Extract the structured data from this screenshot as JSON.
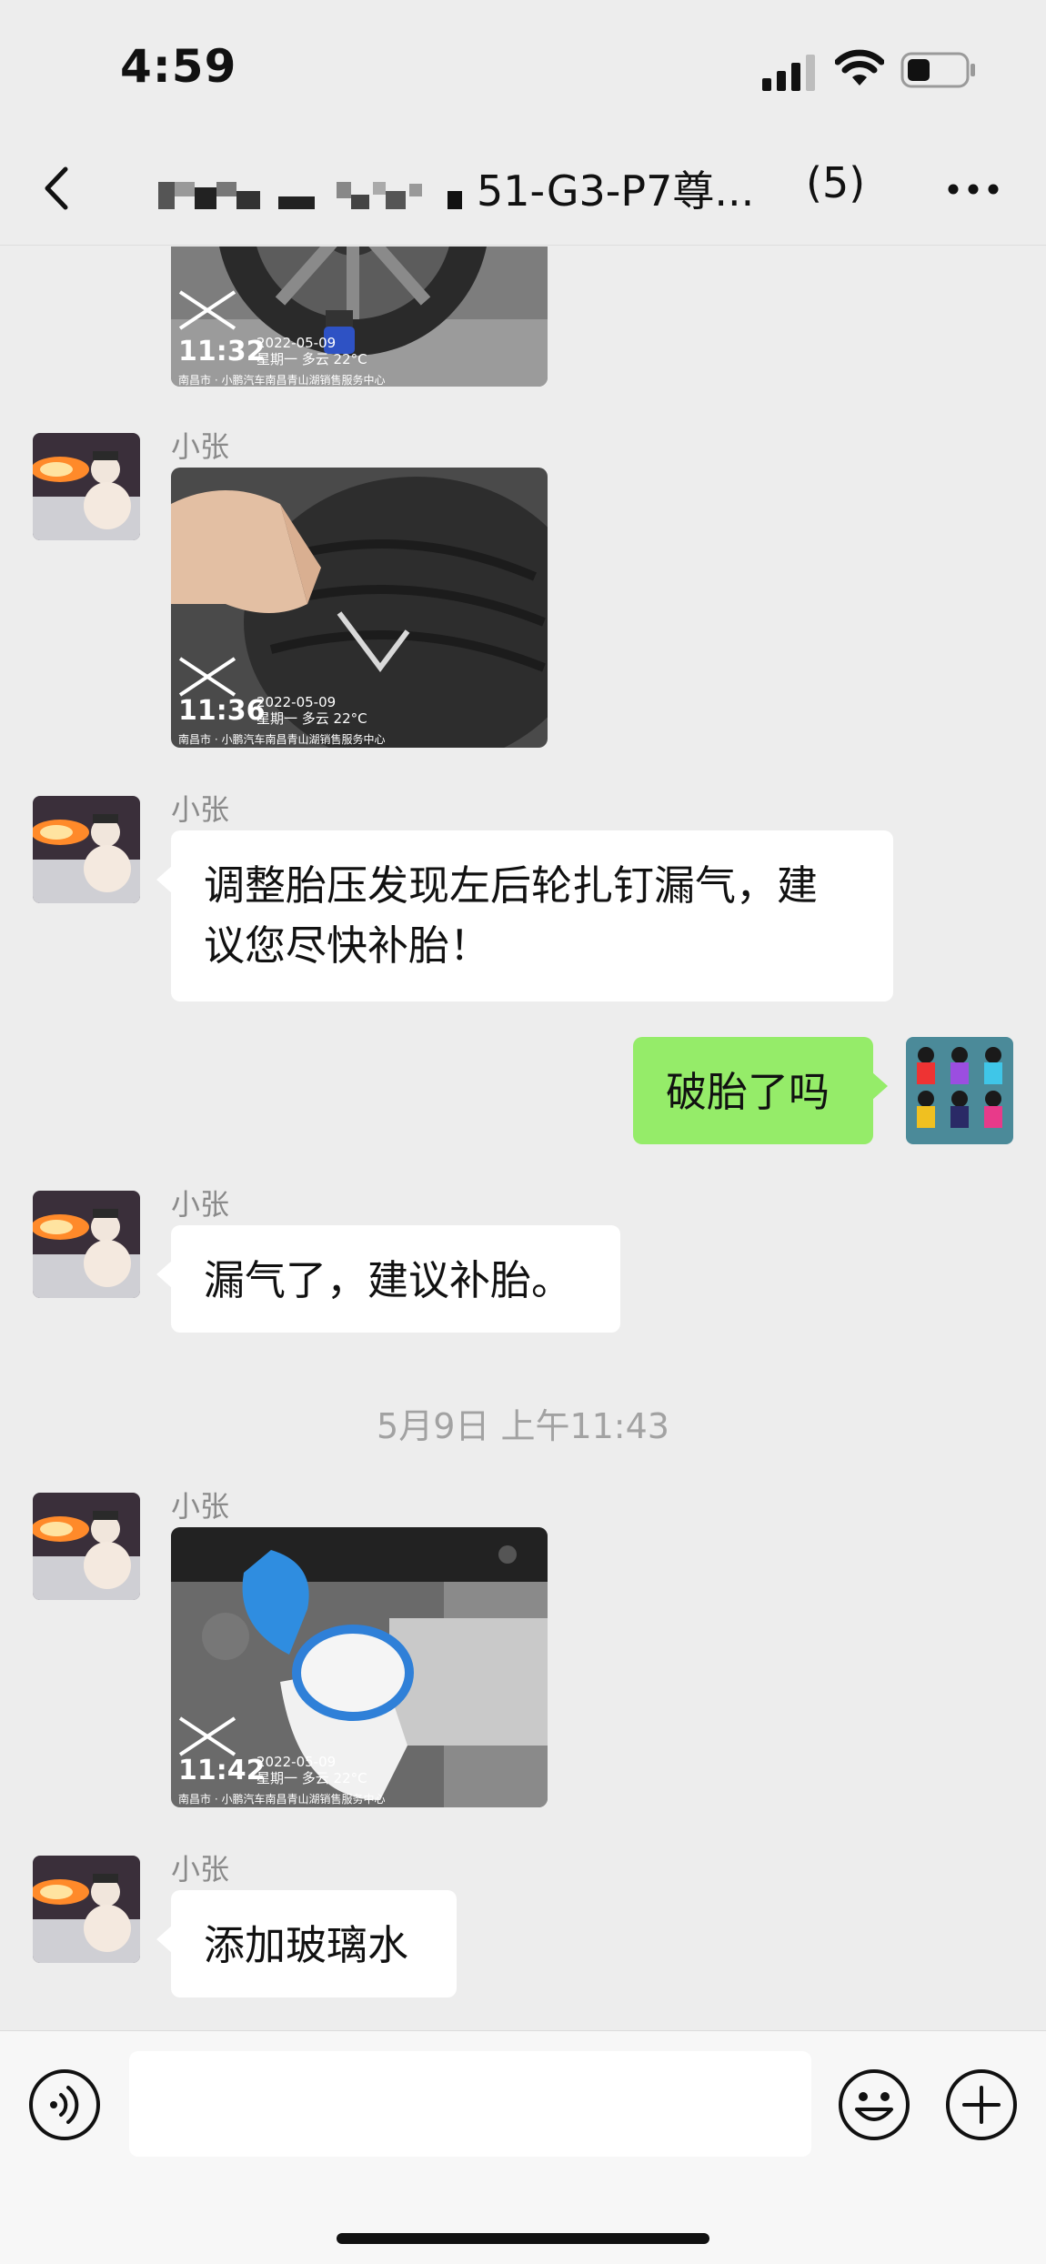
{
  "status_bar": {
    "time": "4:59"
  },
  "nav": {
    "title": "51-G3-P7尊...",
    "member_count": "(5)"
  },
  "messages": [
    {
      "type": "image",
      "watermark_time": "11:32",
      "watermark_date": "2022-05-09",
      "watermark_weather": "星期一 多云 22°C",
      "watermark_location": "南昌市 · 小鹏汽车南昌青山湖销售服务中心"
    },
    {
      "type": "image",
      "sender": "小张",
      "watermark_time": "11:36",
      "watermark_date": "2022-05-09",
      "watermark_weather": "星期一 多云 22°C",
      "watermark_location": "南昌市 · 小鹏汽车南昌青山湖销售服务中心"
    },
    {
      "type": "text",
      "sender": "小张",
      "line1": "调整胎压发现左后轮扎钉漏气，建",
      "line2": "议您尽快补胎！"
    },
    {
      "type": "text",
      "sender": "me",
      "text": "破胎了吗"
    },
    {
      "type": "text",
      "sender": "小张",
      "text": "漏气了，建议补胎。"
    },
    {
      "type": "image",
      "sender": "小张",
      "watermark_time": "11:42",
      "watermark_date": "2022-05-09",
      "watermark_weather": "星期一 多云 22°C",
      "watermark_location": "南昌市 · 小鹏汽车南昌青山湖销售服务中心"
    },
    {
      "type": "text",
      "sender": "小张",
      "text": "添加玻璃水"
    }
  ],
  "timestamp": "5月9日 上午11:43",
  "input_bar": {
    "voice_icon": "voice-icon",
    "emoji_icon": "emoji-icon",
    "plus_icon": "plus-icon"
  },
  "colors": {
    "background": "#ededed",
    "my_bubble": "#95ec69",
    "their_bubble": "#ffffff"
  }
}
